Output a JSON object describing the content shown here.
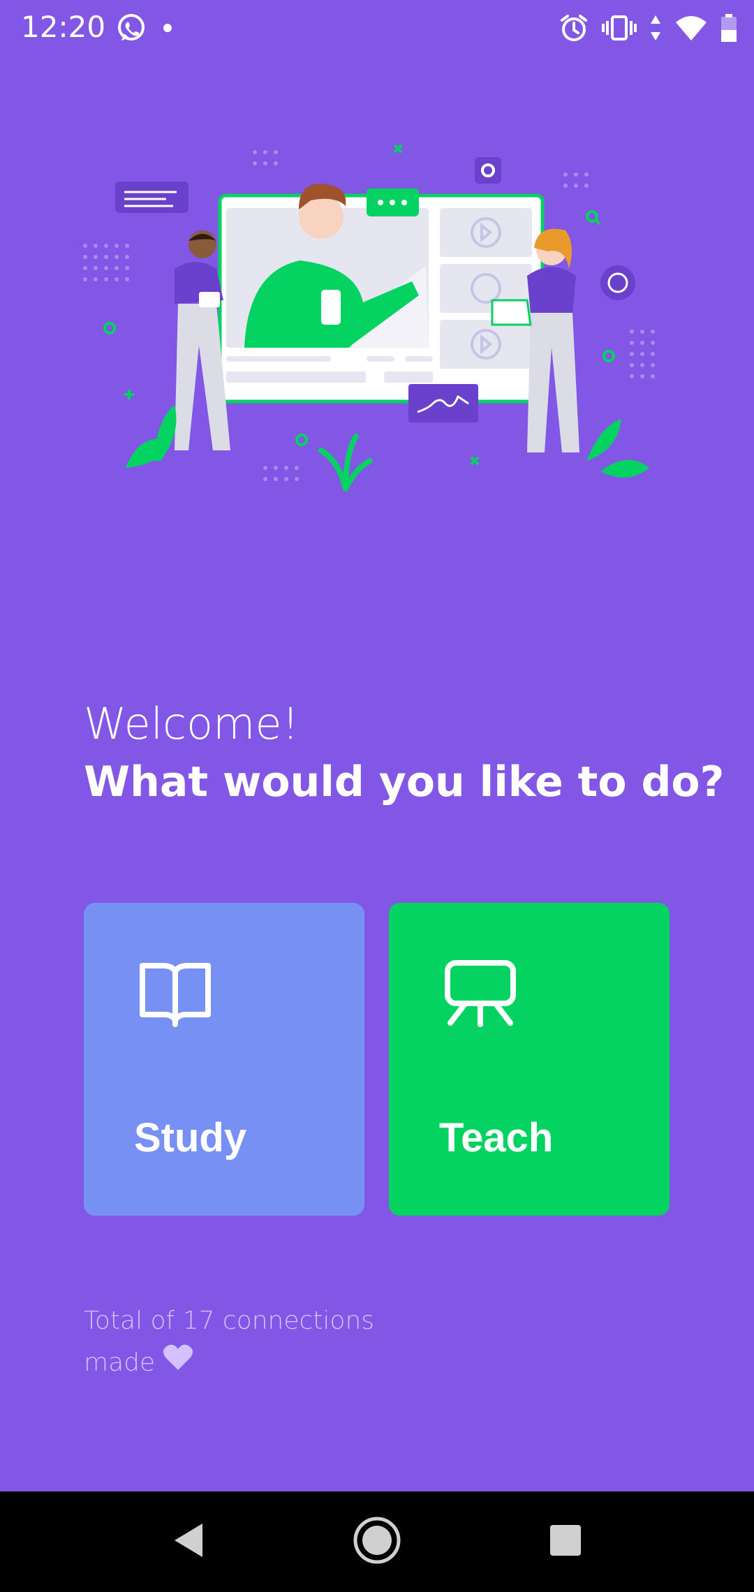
{
  "status_bar": {
    "time": "12:20",
    "left_icons": [
      "whatsapp-icon",
      "dot-icon"
    ],
    "right_icons": [
      "alarm-icon",
      "vibrate-icon",
      "data-arrows-icon",
      "wifi-icon",
      "battery-icon"
    ]
  },
  "hero": {
    "illustration": "online-classroom-illustration"
  },
  "heading": {
    "welcome": "Welcome!",
    "question": "What would you like to do?"
  },
  "actions": {
    "study": {
      "label": "Study",
      "icon": "book-open-icon",
      "color": "#7790F4"
    },
    "teach": {
      "label": "Teach",
      "icon": "presentation-board-icon",
      "color": "#04D361"
    }
  },
  "footer": {
    "connections_text": "Total of 17 connections made",
    "heart_icon": "heart-icon"
  },
  "colors": {
    "background": "#8257E5",
    "accent_green": "#04D361",
    "study_blue": "#7790F4",
    "muted_text": "#D4C2FF"
  },
  "nav": {
    "buttons": [
      "back",
      "home",
      "recent-apps"
    ]
  }
}
